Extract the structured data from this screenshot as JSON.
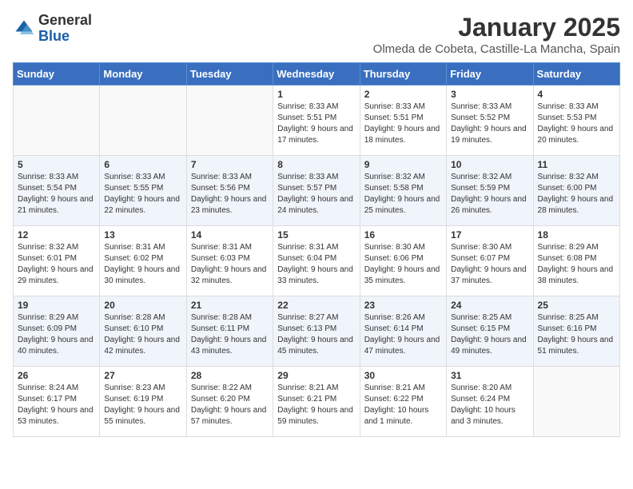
{
  "header": {
    "logo_general": "General",
    "logo_blue": "Blue",
    "month": "January 2025",
    "location": "Olmeda de Cobeta, Castille-La Mancha, Spain"
  },
  "days_of_week": [
    "Sunday",
    "Monday",
    "Tuesday",
    "Wednesday",
    "Thursday",
    "Friday",
    "Saturday"
  ],
  "weeks": [
    [
      {
        "day": "",
        "info": ""
      },
      {
        "day": "",
        "info": ""
      },
      {
        "day": "",
        "info": ""
      },
      {
        "day": "1",
        "info": "Sunrise: 8:33 AM\nSunset: 5:51 PM\nDaylight: 9 hours and 17 minutes."
      },
      {
        "day": "2",
        "info": "Sunrise: 8:33 AM\nSunset: 5:51 PM\nDaylight: 9 hours and 18 minutes."
      },
      {
        "day": "3",
        "info": "Sunrise: 8:33 AM\nSunset: 5:52 PM\nDaylight: 9 hours and 19 minutes."
      },
      {
        "day": "4",
        "info": "Sunrise: 8:33 AM\nSunset: 5:53 PM\nDaylight: 9 hours and 20 minutes."
      }
    ],
    [
      {
        "day": "5",
        "info": "Sunrise: 8:33 AM\nSunset: 5:54 PM\nDaylight: 9 hours and 21 minutes."
      },
      {
        "day": "6",
        "info": "Sunrise: 8:33 AM\nSunset: 5:55 PM\nDaylight: 9 hours and 22 minutes."
      },
      {
        "day": "7",
        "info": "Sunrise: 8:33 AM\nSunset: 5:56 PM\nDaylight: 9 hours and 23 minutes."
      },
      {
        "day": "8",
        "info": "Sunrise: 8:33 AM\nSunset: 5:57 PM\nDaylight: 9 hours and 24 minutes."
      },
      {
        "day": "9",
        "info": "Sunrise: 8:32 AM\nSunset: 5:58 PM\nDaylight: 9 hours and 25 minutes."
      },
      {
        "day": "10",
        "info": "Sunrise: 8:32 AM\nSunset: 5:59 PM\nDaylight: 9 hours and 26 minutes."
      },
      {
        "day": "11",
        "info": "Sunrise: 8:32 AM\nSunset: 6:00 PM\nDaylight: 9 hours and 28 minutes."
      }
    ],
    [
      {
        "day": "12",
        "info": "Sunrise: 8:32 AM\nSunset: 6:01 PM\nDaylight: 9 hours and 29 minutes."
      },
      {
        "day": "13",
        "info": "Sunrise: 8:31 AM\nSunset: 6:02 PM\nDaylight: 9 hours and 30 minutes."
      },
      {
        "day": "14",
        "info": "Sunrise: 8:31 AM\nSunset: 6:03 PM\nDaylight: 9 hours and 32 minutes."
      },
      {
        "day": "15",
        "info": "Sunrise: 8:31 AM\nSunset: 6:04 PM\nDaylight: 9 hours and 33 minutes."
      },
      {
        "day": "16",
        "info": "Sunrise: 8:30 AM\nSunset: 6:06 PM\nDaylight: 9 hours and 35 minutes."
      },
      {
        "day": "17",
        "info": "Sunrise: 8:30 AM\nSunset: 6:07 PM\nDaylight: 9 hours and 37 minutes."
      },
      {
        "day": "18",
        "info": "Sunrise: 8:29 AM\nSunset: 6:08 PM\nDaylight: 9 hours and 38 minutes."
      }
    ],
    [
      {
        "day": "19",
        "info": "Sunrise: 8:29 AM\nSunset: 6:09 PM\nDaylight: 9 hours and 40 minutes."
      },
      {
        "day": "20",
        "info": "Sunrise: 8:28 AM\nSunset: 6:10 PM\nDaylight: 9 hours and 42 minutes."
      },
      {
        "day": "21",
        "info": "Sunrise: 8:28 AM\nSunset: 6:11 PM\nDaylight: 9 hours and 43 minutes."
      },
      {
        "day": "22",
        "info": "Sunrise: 8:27 AM\nSunset: 6:13 PM\nDaylight: 9 hours and 45 minutes."
      },
      {
        "day": "23",
        "info": "Sunrise: 8:26 AM\nSunset: 6:14 PM\nDaylight: 9 hours and 47 minutes."
      },
      {
        "day": "24",
        "info": "Sunrise: 8:25 AM\nSunset: 6:15 PM\nDaylight: 9 hours and 49 minutes."
      },
      {
        "day": "25",
        "info": "Sunrise: 8:25 AM\nSunset: 6:16 PM\nDaylight: 9 hours and 51 minutes."
      }
    ],
    [
      {
        "day": "26",
        "info": "Sunrise: 8:24 AM\nSunset: 6:17 PM\nDaylight: 9 hours and 53 minutes."
      },
      {
        "day": "27",
        "info": "Sunrise: 8:23 AM\nSunset: 6:19 PM\nDaylight: 9 hours and 55 minutes."
      },
      {
        "day": "28",
        "info": "Sunrise: 8:22 AM\nSunset: 6:20 PM\nDaylight: 9 hours and 57 minutes."
      },
      {
        "day": "29",
        "info": "Sunrise: 8:21 AM\nSunset: 6:21 PM\nDaylight: 9 hours and 59 minutes."
      },
      {
        "day": "30",
        "info": "Sunrise: 8:21 AM\nSunset: 6:22 PM\nDaylight: 10 hours and 1 minute."
      },
      {
        "day": "31",
        "info": "Sunrise: 8:20 AM\nSunset: 6:24 PM\nDaylight: 10 hours and 3 minutes."
      },
      {
        "day": "",
        "info": ""
      }
    ]
  ]
}
